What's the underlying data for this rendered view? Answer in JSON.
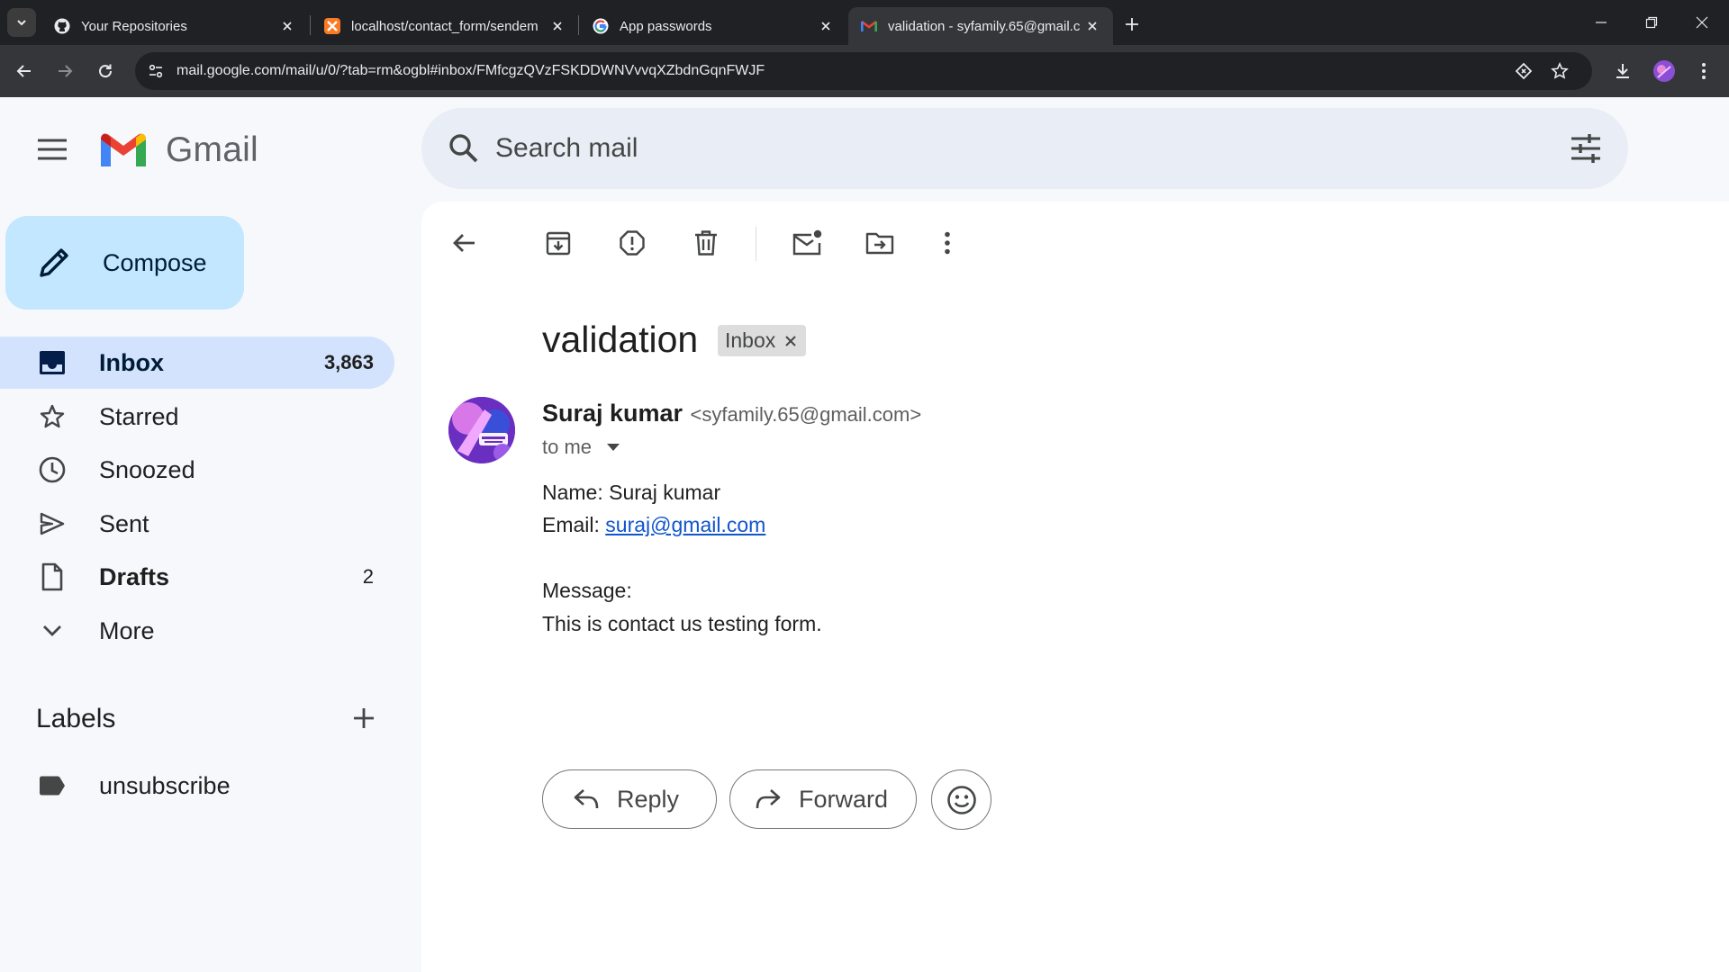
{
  "browser": {
    "tabs": [
      {
        "title": "Your Repositories",
        "favicon": "github-icon",
        "active": false
      },
      {
        "title": "localhost/contact_form/sendem",
        "favicon": "xampp-icon",
        "active": false
      },
      {
        "title": "App passwords",
        "favicon": "google-icon",
        "active": false
      },
      {
        "title": "validation - syfamily.65@gmail.c",
        "favicon": "gmail-icon",
        "active": true
      }
    ],
    "url": "mail.google.com/mail/u/0/?tab=rm&ogbl#inbox/FMfcgzQVzFSKDDWNVvvqXZbdnGqnFWJF",
    "colors": {
      "tabstrip": "#202124",
      "toolbar": "#35363a"
    }
  },
  "gmail": {
    "wordmark": "Gmail",
    "search": {
      "placeholder": "Search mail"
    },
    "compose_label": "Compose",
    "nav": [
      {
        "label": "Inbox",
        "count": "3,863",
        "icon": "inbox-icon",
        "active": true,
        "bold": true
      },
      {
        "label": "Starred",
        "count": "",
        "icon": "star-icon",
        "active": false,
        "bold": false
      },
      {
        "label": "Snoozed",
        "count": "",
        "icon": "clock-icon",
        "active": false,
        "bold": false
      },
      {
        "label": "Sent",
        "count": "",
        "icon": "send-icon",
        "active": false,
        "bold": false
      },
      {
        "label": "Drafts",
        "count": "2",
        "icon": "draft-icon",
        "active": false,
        "bold": true
      },
      {
        "label": "More",
        "count": "",
        "icon": "chevron-down-icon",
        "active": false,
        "bold": false
      }
    ],
    "labels_title": "Labels",
    "labels": [
      {
        "label": "unsubscribe",
        "icon": "label-icon"
      }
    ],
    "colors": {
      "compose": "#c2e7ff",
      "active_nav": "#d3e3fd",
      "search": "#e9eef6",
      "link": "#1155cc"
    }
  },
  "email": {
    "subject": "validation",
    "chip": "Inbox",
    "sender_name": "Suraj kumar",
    "sender_email": "<syfamily.65@gmail.com>",
    "recipient": "to me",
    "body": {
      "name_line": "Name: Suraj kumar",
      "email_prefix": "Email: ",
      "email_link": "suraj@gmail.com",
      "message_label": "Message:",
      "message_text": "This is contact us testing form."
    },
    "reply_label": "Reply",
    "forward_label": "Forward"
  }
}
